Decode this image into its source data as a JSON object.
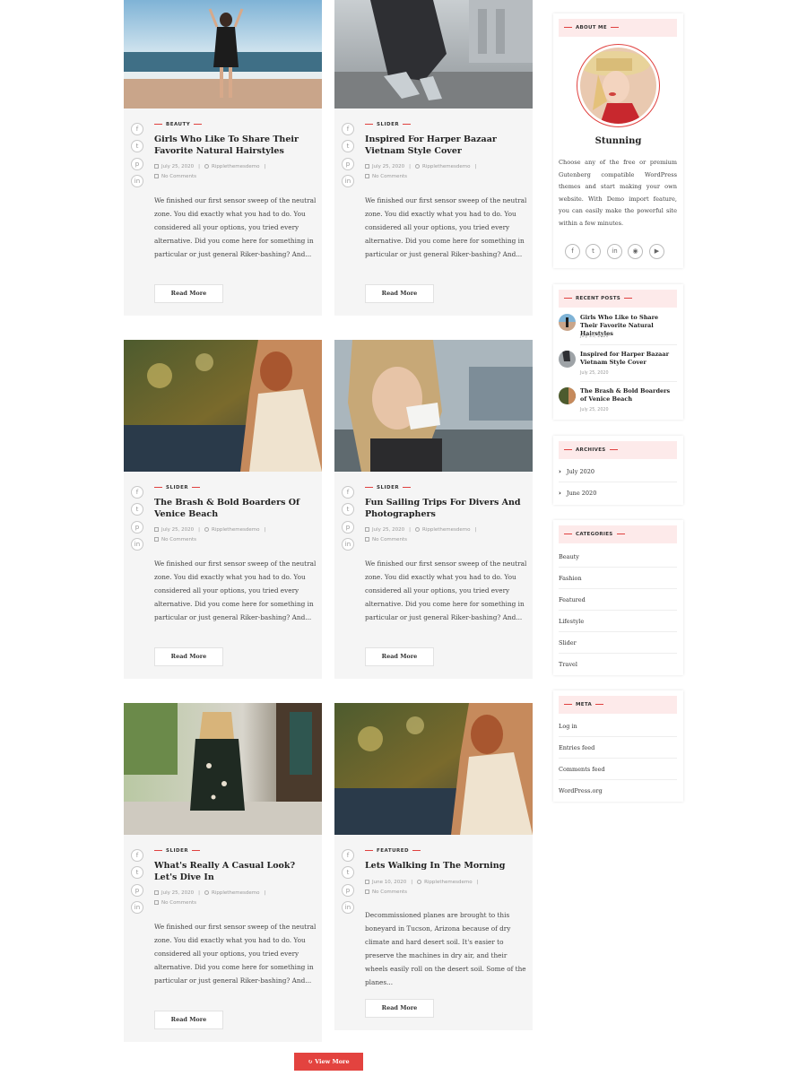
{
  "posts": [
    {
      "category": "BEAUTY",
      "title": "Girls Who Like To Share Their Favorite Natural Hairstyles",
      "date": "July 25, 2020",
      "author": "Ripplethemesdemo",
      "comments": "No Comments",
      "excerpt": "We finished our first sensor sweep of the neutral zone. You did exactly what you had to do. You considered all your options, you tried every alternative. Did you come here for something in particular or just general Riker-bashing? And...",
      "read_more": "Read More"
    },
    {
      "category": "SLIDER",
      "title": "Inspired For Harper Bazaar Vietnam Style Cover",
      "date": "July 25, 2020",
      "author": "Ripplethemesdemo",
      "comments": "No Comments",
      "excerpt": "We finished our first sensor sweep of the neutral zone. You did exactly what you had to do. You considered all your options, you tried every alternative. Did you come here for something in particular or just general Riker-bashing? And...",
      "read_more": "Read More"
    },
    {
      "category": "SLIDER",
      "title": "The Brash & Bold Boarders Of Venice Beach",
      "date": "July 25, 2020",
      "author": "Ripplethemesdemo",
      "comments": "No Comments",
      "excerpt": "We finished our first sensor sweep of the neutral zone. You did exactly what you had to do. You considered all your options, you tried every alternative. Did you come here for something in particular or just general Riker-bashing? And...",
      "read_more": "Read More"
    },
    {
      "category": "SLIDER",
      "title": "Fun Sailing Trips For Divers And Photographers",
      "date": "July 25, 2020",
      "author": "Ripplethemesdemo",
      "comments": "No Comments",
      "excerpt": "We finished our first sensor sweep of the neutral zone. You did exactly what you had to do. You considered all your options, you tried every alternative. Did you come here for something in particular or just general Riker-bashing? And...",
      "read_more": "Read More"
    },
    {
      "category": "SLIDER",
      "title": "What's Really A Casual Look? Let's Dive In",
      "date": "July 25, 2020",
      "author": "Ripplethemesdemo",
      "comments": "No Comments",
      "excerpt": "We finished our first sensor sweep of the neutral zone. You did exactly what you had to do. You considered all your options, you tried every alternative. Did you come here for something in particular or just general Riker-bashing? And...",
      "read_more": "Read More"
    },
    {
      "category": "FEATURED",
      "title": "Lets Walking In The Morning",
      "date": "June 10, 2020",
      "author": "Ripplethemesdemo",
      "comments": "No Comments",
      "excerpt": "Decommissioned planes are brought to this boneyard in Tucson, Arizona because of dry climate and hard desert soil. It's easier to preserve the machines in dry air, and their wheels easily roll on the desert soil. Some of the planes...",
      "read_more": "Read More"
    }
  ],
  "share_icons": [
    "facebook-icon",
    "twitter-icon",
    "pinterest-icon",
    "linkedin-icon"
  ],
  "view_more": "View More",
  "sidebar": {
    "about": {
      "heading": "ABOUT ME",
      "name": "Stunning",
      "text": "Choose any of the free or premium Gutenberg compatible WordPress themes and start making your own website. With Demo import feature, you can easily make the powerful site within a few minutes.",
      "socials": [
        "facebook-icon",
        "twitter-icon",
        "linkedin-icon",
        "instagram-icon",
        "youtube-icon"
      ]
    },
    "recent": {
      "heading": "RECENT POSTS",
      "items": [
        {
          "title": "Girls Who Like to Share Their Favorite Natural Hairstyles",
          "date": "July 25, 2020"
        },
        {
          "title": "Inspired for Harper Bazaar Vietnam Style Cover",
          "date": "July 25, 2020"
        },
        {
          "title": "The Brash & Bold Boarders of Venice Beach",
          "date": "July 25, 2020"
        }
      ]
    },
    "archives": {
      "heading": "ARCHIVES",
      "items": [
        "July 2020",
        "June 2020"
      ]
    },
    "categories": {
      "heading": "CATEGORIES",
      "items": [
        "Beauty",
        "Fashion",
        "Featured",
        "Lifestyle",
        "Slider",
        "Travel"
      ]
    },
    "meta": {
      "heading": "META",
      "items": [
        "Log in",
        "Entries feed",
        "Comments feed",
        "WordPress.org"
      ]
    }
  },
  "colors": {
    "accent": "#e3433f",
    "widget_head_bg": "#fdeaea",
    "card_bg": "#f5f5f5"
  }
}
